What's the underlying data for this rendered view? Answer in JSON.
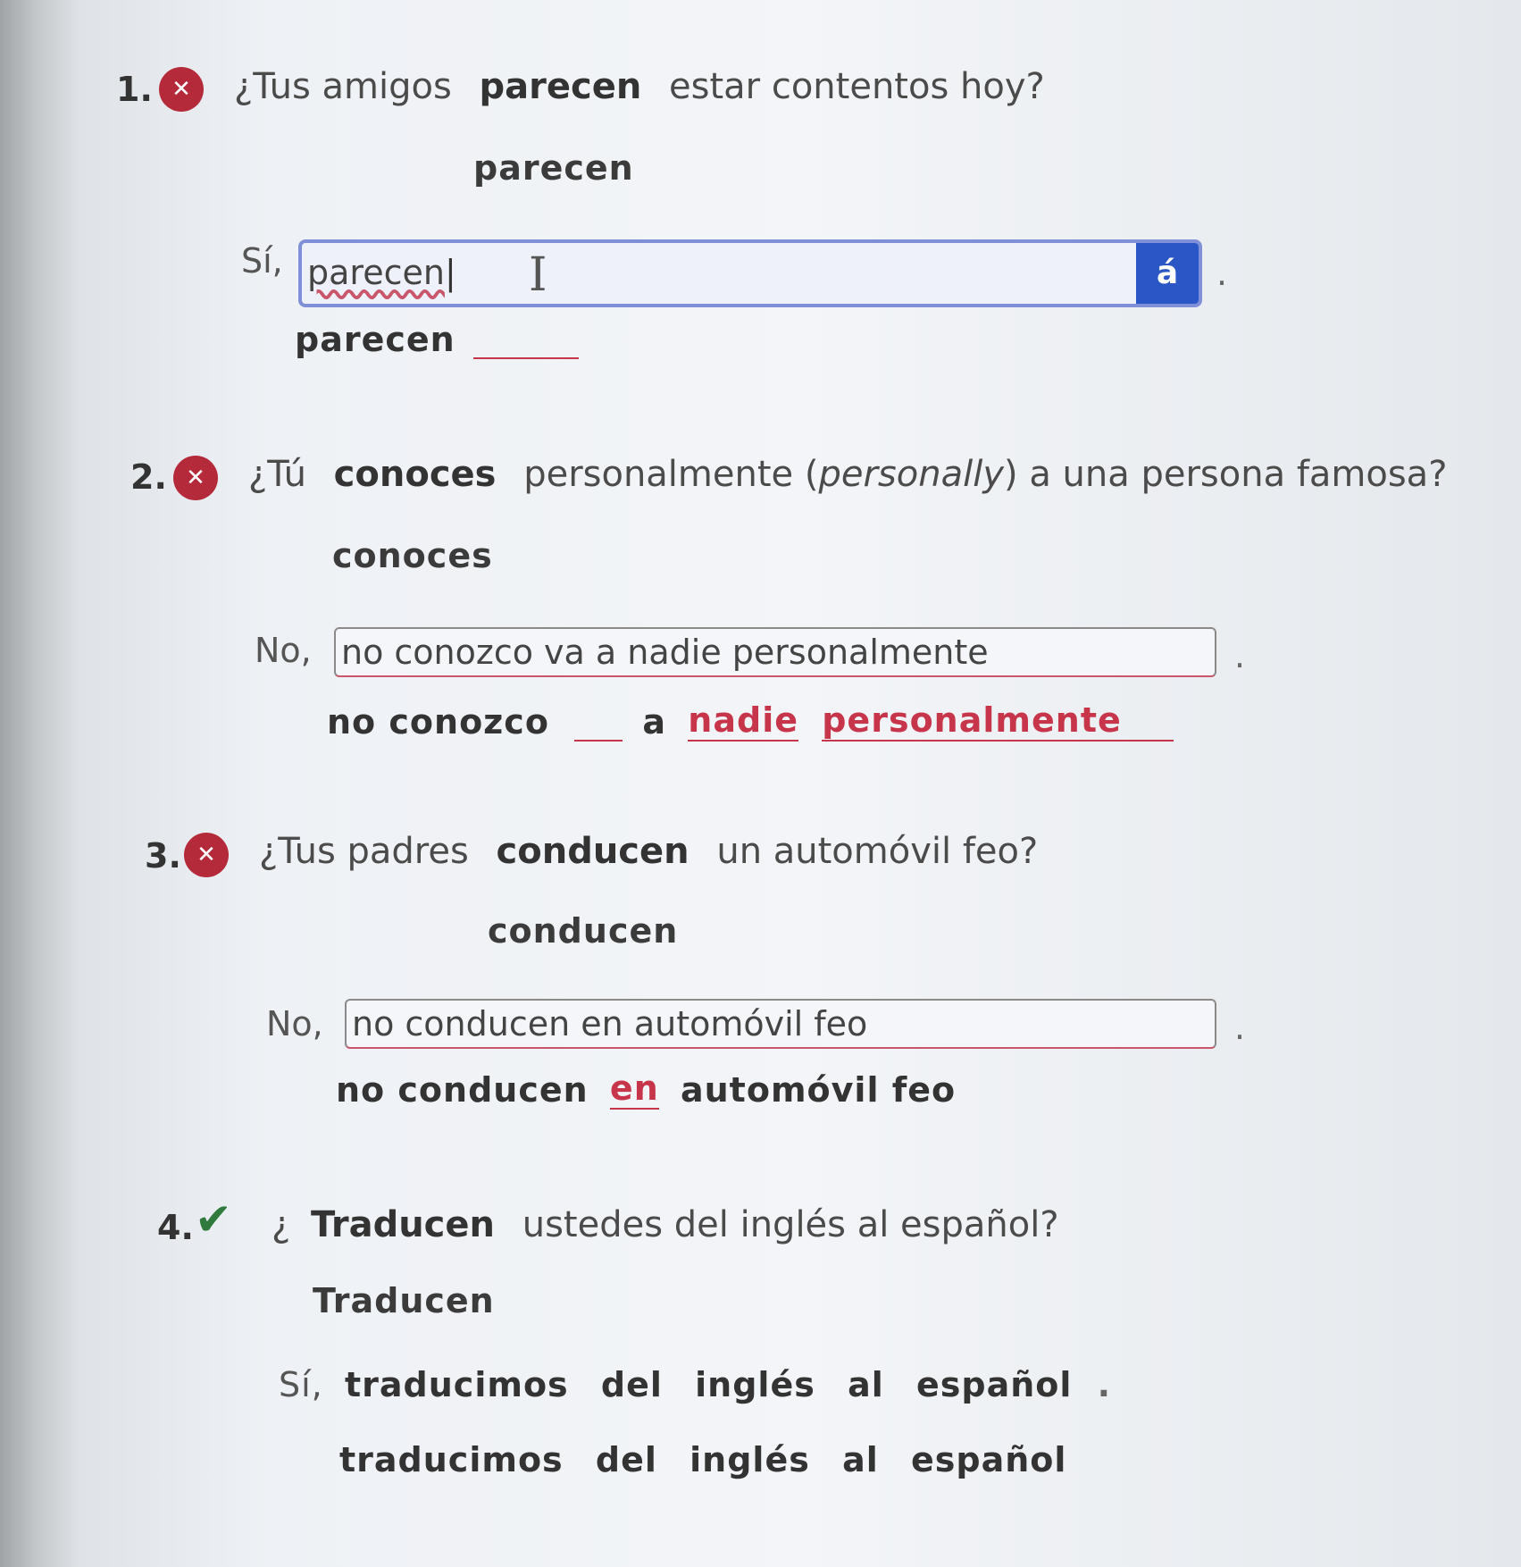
{
  "questions": [
    {
      "number": "1.",
      "status": "incorrect",
      "icon": "x-icon",
      "text_before": "¿Tus amigos",
      "verb": "parecen",
      "text_after": "estar contentos hoy?",
      "hint": "parecen",
      "answer_prefix": "Sí,",
      "answer_value": "parecen",
      "accent_button": "á",
      "period": ".",
      "feedback_words": [
        "parecen"
      ]
    },
    {
      "number": "2.",
      "status": "incorrect",
      "icon": "x-icon",
      "text_before": "¿Tú",
      "verb": "conoces",
      "text_mid": "personalmente (",
      "text_italic": "personally",
      "text_after": ") a una persona famosa?",
      "hint": "conoces",
      "answer_prefix": "No,",
      "answer_value": "no conozco va a nadie personalmente",
      "period": ".",
      "feedback_words": [
        "no conozco",
        "a",
        "nadie",
        "personalmente"
      ]
    },
    {
      "number": "3.",
      "status": "incorrect",
      "icon": "x-icon",
      "text_before": "¿Tus padres",
      "verb": "conducen",
      "text_after": "un automóvil feo?",
      "hint": "conducen",
      "answer_prefix": "No,",
      "answer_value": "no conducen en automóvil feo",
      "period": ".",
      "feedback_words": [
        "no conducen",
        "en",
        "automóvil feo"
      ]
    },
    {
      "number": "4.",
      "status": "correct",
      "icon": "check-icon",
      "text_before": "¿",
      "verb": "Traducen",
      "text_after": "ustedes del inglés al español?",
      "hint": "Traducen",
      "answer_prefix": "Sí,",
      "answer_words": [
        "traducimos",
        "del",
        "inglés",
        "al",
        "español"
      ],
      "period": ".",
      "feedback_words": [
        "traducimos",
        "del",
        "inglés",
        "al",
        "español"
      ]
    }
  ],
  "colors": {
    "incorrect_badge": "#b52a3a",
    "correct_check": "#2f7a3c",
    "error_text": "#c7354b",
    "accent_button": "#2a56c6",
    "active_field_border": "#7f8fd8"
  }
}
